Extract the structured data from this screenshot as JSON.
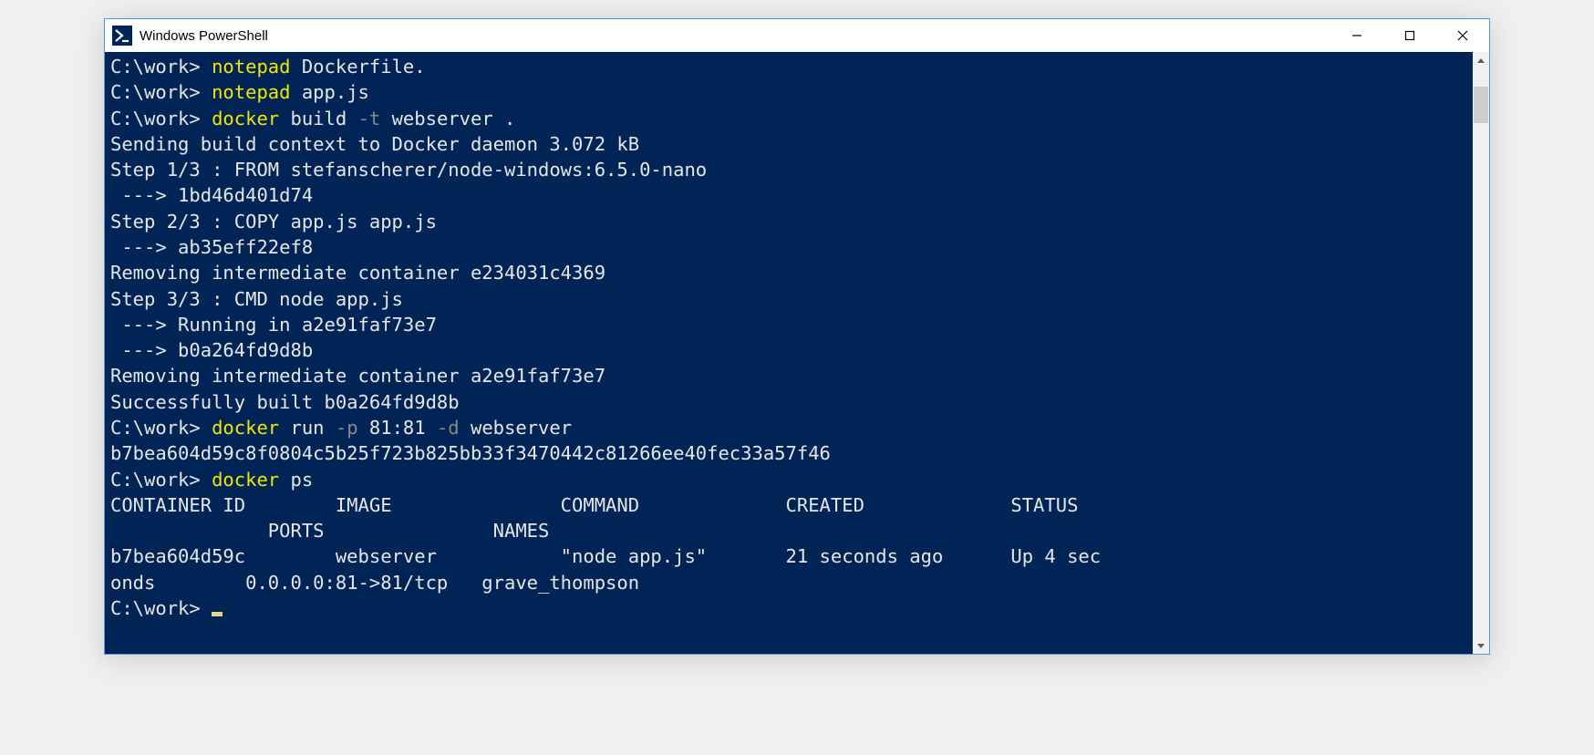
{
  "window": {
    "title": "Windows PowerShell"
  },
  "terminal": {
    "lines": [
      {
        "type": "cmd",
        "prompt": "C:\\work> ",
        "cmd_yellow": "notepad",
        "cmd_rest": " Dockerfile."
      },
      {
        "type": "cmd",
        "prompt": "C:\\work> ",
        "cmd_yellow": "notepad",
        "cmd_rest": " app.js"
      },
      {
        "type": "cmd_build",
        "prompt": "C:\\work> ",
        "cmd_yellow": "docker",
        "cmd_white1": " build ",
        "cmd_gray": "-t",
        "cmd_white2": " webserver ."
      },
      {
        "type": "out",
        "text": "Sending build context to Docker daemon 3.072 kB"
      },
      {
        "type": "out",
        "text": "Step 1/3 : FROM stefanscherer/node-windows:6.5.0-nano"
      },
      {
        "type": "out",
        "text": " ---> 1bd46d401d74"
      },
      {
        "type": "out",
        "text": "Step 2/3 : COPY app.js app.js"
      },
      {
        "type": "out",
        "text": " ---> ab35eff22ef8"
      },
      {
        "type": "out",
        "text": "Removing intermediate container e234031c4369"
      },
      {
        "type": "out",
        "text": "Step 3/3 : CMD node app.js"
      },
      {
        "type": "out",
        "text": " ---> Running in a2e91faf73e7"
      },
      {
        "type": "out",
        "text": " ---> b0a264fd9d8b"
      },
      {
        "type": "out",
        "text": "Removing intermediate container a2e91faf73e7"
      },
      {
        "type": "out",
        "text": "Successfully built b0a264fd9d8b"
      },
      {
        "type": "cmd_run",
        "prompt": "C:\\work> ",
        "cmd_yellow": "docker",
        "cmd_white1": " run ",
        "cmd_gray1": "-p",
        "cmd_white2": " 81:81 ",
        "cmd_gray2": "-d",
        "cmd_white3": " webserver"
      },
      {
        "type": "out",
        "text": "b7bea604d59c8f0804c5b25f723b825bb33f3470442c81266ee40fec33a57f46"
      },
      {
        "type": "cmd",
        "prompt": "C:\\work> ",
        "cmd_yellow": "docker",
        "cmd_rest": " ps"
      },
      {
        "type": "out",
        "text": "CONTAINER ID        IMAGE               COMMAND             CREATED             STATUS"
      },
      {
        "type": "out",
        "text": "              PORTS               NAMES"
      },
      {
        "type": "out",
        "text": "b7bea604d59c        webserver           \"node app.js\"       21 seconds ago      Up 4 sec"
      },
      {
        "type": "out",
        "text": "onds        0.0.0.0:81->81/tcp   grave_thompson"
      },
      {
        "type": "prompt_cursor",
        "prompt": "C:\\work> "
      }
    ]
  },
  "docker_ps_table": {
    "headers": [
      "CONTAINER ID",
      "IMAGE",
      "COMMAND",
      "CREATED",
      "STATUS",
      "PORTS",
      "NAMES"
    ],
    "rows": [
      {
        "container_id": "b7bea604d59c",
        "image": "webserver",
        "command": "\"node app.js\"",
        "created": "21 seconds ago",
        "status": "Up 4 seconds",
        "ports": "0.0.0.0:81->81/tcp",
        "names": "grave_thompson"
      }
    ]
  }
}
